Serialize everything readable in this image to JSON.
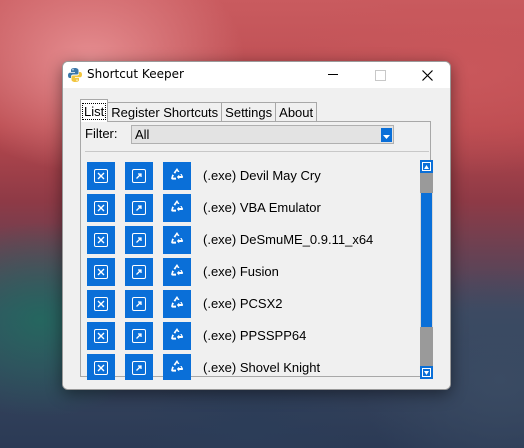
{
  "window": {
    "title": "Shortcut Keeper"
  },
  "tabs": [
    {
      "label": "List"
    },
    {
      "label": "Register Shortcuts"
    },
    {
      "label": "Settings"
    },
    {
      "label": "About"
    }
  ],
  "filter": {
    "label": "Filter:",
    "value": "All"
  },
  "items": [
    {
      "label": "(.exe) Devil May Cry"
    },
    {
      "label": "(.exe) VBA Emulator"
    },
    {
      "label": "(.exe) DeSmuME_0.9.11_x64"
    },
    {
      "label": "(.exe) Fusion"
    },
    {
      "label": "(.exe) PCSX2"
    },
    {
      "label": "(.exe) PPSSPP64"
    },
    {
      "label": "(.exe) Shovel Knight"
    }
  ],
  "colors": {
    "accent": "#0a6fd8",
    "panel": "#f0f0f0"
  },
  "icons": {
    "row_buttons": [
      "delete-icon",
      "open-shortcut-icon",
      "recycle-icon"
    ],
    "app": "python-icon"
  }
}
